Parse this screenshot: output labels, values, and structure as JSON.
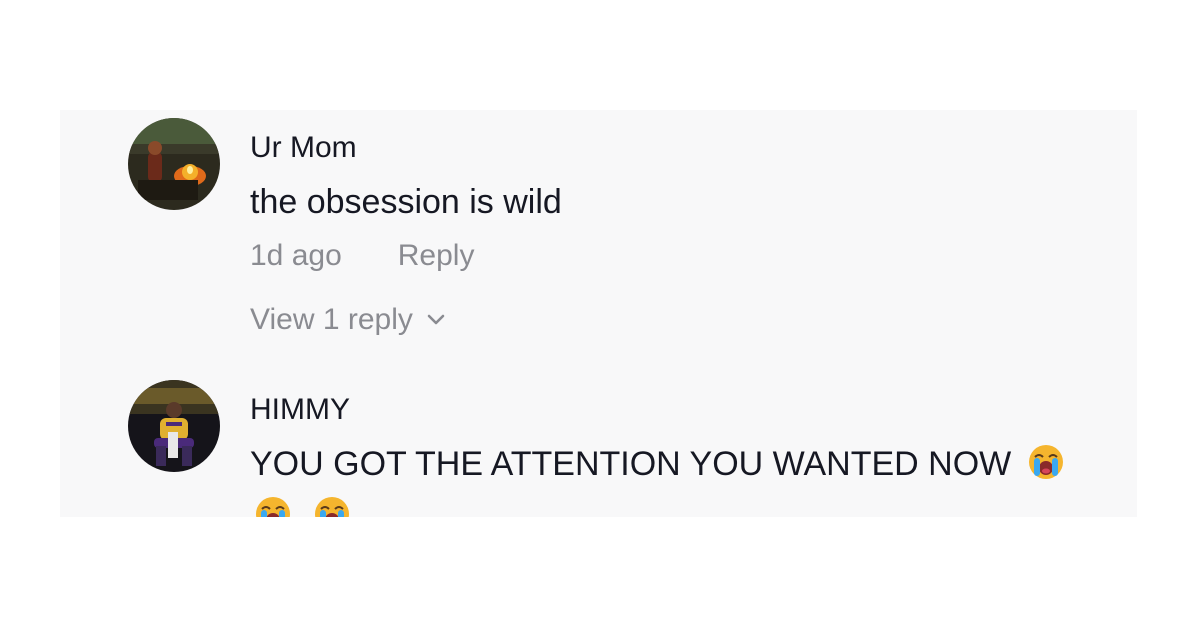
{
  "comments": [
    {
      "author": "Ur Mom",
      "text": "the obsession is wild",
      "time": "1d ago",
      "reply_label": "Reply",
      "view_replies": "View 1 reply",
      "avatar_icon": "campfire-avatar"
    },
    {
      "author": "HIMMY",
      "text": "YOU GOT THE ATTENTION YOU WANTED NOW",
      "emoji": "loudly-crying-face",
      "emoji_count": 3,
      "avatar_icon": "seated-player-avatar"
    }
  ],
  "colors": {
    "panel_bg": "#f8f8f9",
    "text_primary": "#161823",
    "text_secondary": "#8a8b91"
  }
}
